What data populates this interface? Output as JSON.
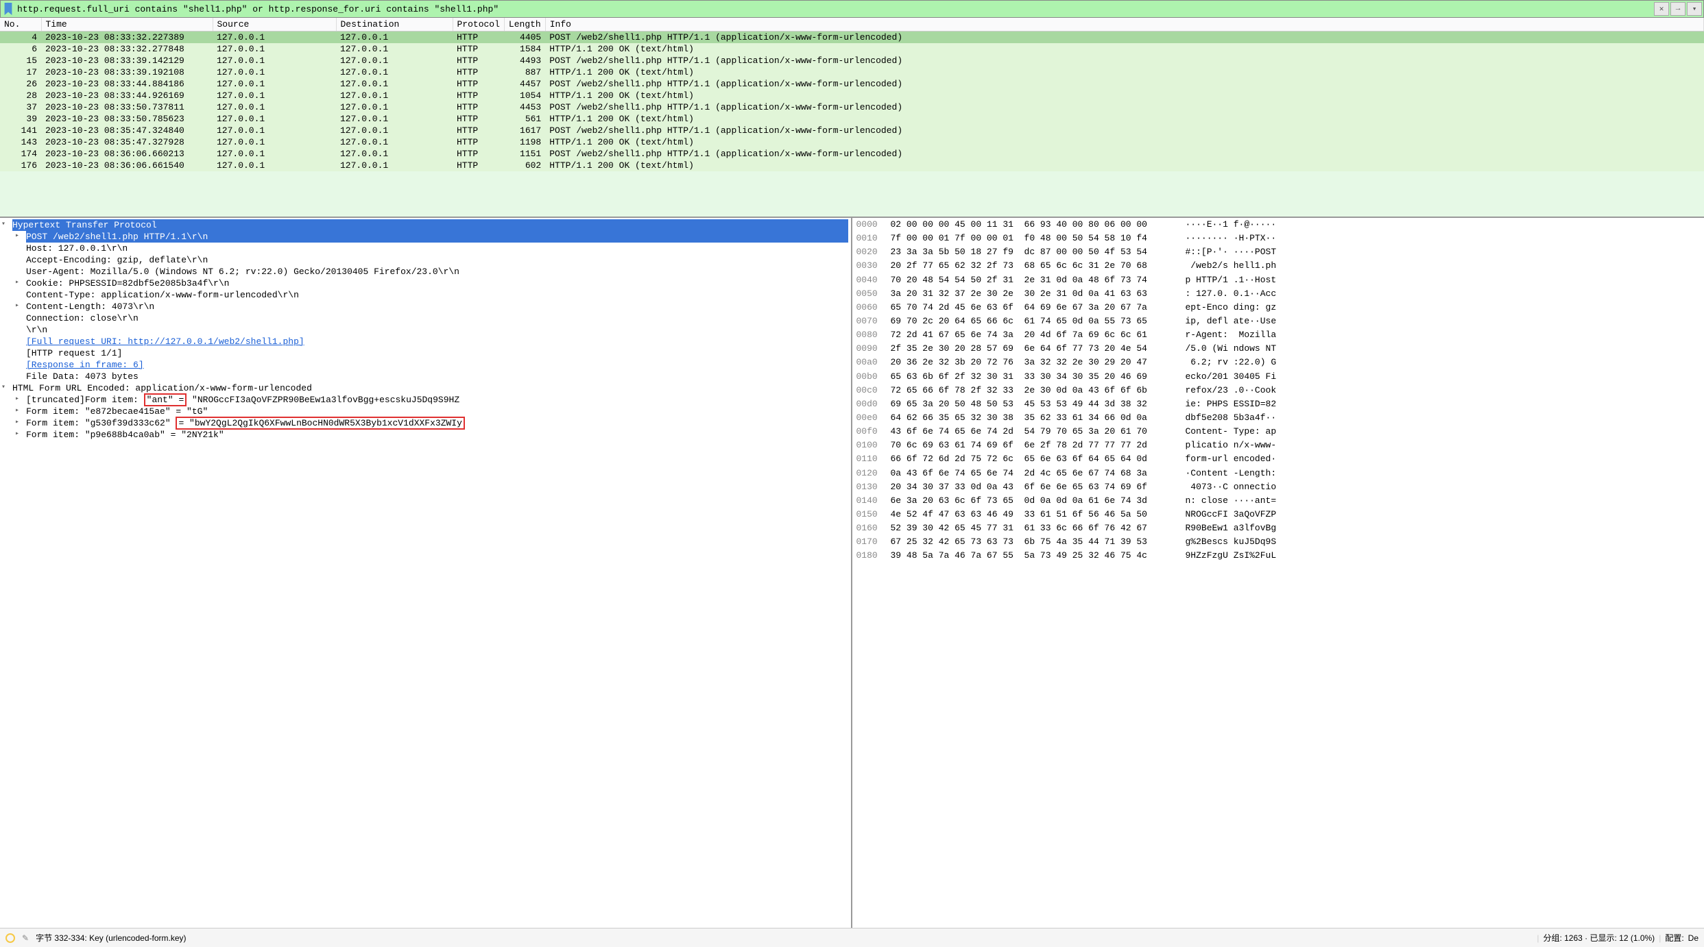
{
  "filter": {
    "text": "http.request.full_uri contains \"shell1.php\" or http.response_for.uri contains \"shell1.php\""
  },
  "columns": {
    "no": "No.",
    "time": "Time",
    "source": "Source",
    "destination": "Destination",
    "protocol": "Protocol",
    "length": "Length",
    "info": "Info"
  },
  "packets": [
    {
      "no": "4",
      "time": "2023-10-23 08:33:32.227389",
      "src": "127.0.0.1",
      "dst": "127.0.0.1",
      "proto": "HTTP",
      "len": "4405",
      "info": "POST /web2/shell1.php HTTP/1.1  (application/x-www-form-urlencoded)",
      "sel": true
    },
    {
      "no": "6",
      "time": "2023-10-23 08:33:32.277848",
      "src": "127.0.0.1",
      "dst": "127.0.0.1",
      "proto": "HTTP",
      "len": "1584",
      "info": "HTTP/1.1 200 OK  (text/html)"
    },
    {
      "no": "15",
      "time": "2023-10-23 08:33:39.142129",
      "src": "127.0.0.1",
      "dst": "127.0.0.1",
      "proto": "HTTP",
      "len": "4493",
      "info": "POST /web2/shell1.php HTTP/1.1  (application/x-www-form-urlencoded)"
    },
    {
      "no": "17",
      "time": "2023-10-23 08:33:39.192108",
      "src": "127.0.0.1",
      "dst": "127.0.0.1",
      "proto": "HTTP",
      "len": "887",
      "info": "HTTP/1.1 200 OK  (text/html)"
    },
    {
      "no": "26",
      "time": "2023-10-23 08:33:44.884186",
      "src": "127.0.0.1",
      "dst": "127.0.0.1",
      "proto": "HTTP",
      "len": "4457",
      "info": "POST /web2/shell1.php HTTP/1.1  (application/x-www-form-urlencoded)"
    },
    {
      "no": "28",
      "time": "2023-10-23 08:33:44.926169",
      "src": "127.0.0.1",
      "dst": "127.0.0.1",
      "proto": "HTTP",
      "len": "1054",
      "info": "HTTP/1.1 200 OK  (text/html)"
    },
    {
      "no": "37",
      "time": "2023-10-23 08:33:50.737811",
      "src": "127.0.0.1",
      "dst": "127.0.0.1",
      "proto": "HTTP",
      "len": "4453",
      "info": "POST /web2/shell1.php HTTP/1.1  (application/x-www-form-urlencoded)"
    },
    {
      "no": "39",
      "time": "2023-10-23 08:33:50.785623",
      "src": "127.0.0.1",
      "dst": "127.0.0.1",
      "proto": "HTTP",
      "len": "561",
      "info": "HTTP/1.1 200 OK  (text/html)"
    },
    {
      "no": "141",
      "time": "2023-10-23 08:35:47.324840",
      "src": "127.0.0.1",
      "dst": "127.0.0.1",
      "proto": "HTTP",
      "len": "1617",
      "info": "POST /web2/shell1.php HTTP/1.1  (application/x-www-form-urlencoded)"
    },
    {
      "no": "143",
      "time": "2023-10-23 08:35:47.327928",
      "src": "127.0.0.1",
      "dst": "127.0.0.1",
      "proto": "HTTP",
      "len": "1198",
      "info": "HTTP/1.1 200 OK  (text/html)"
    },
    {
      "no": "174",
      "time": "2023-10-23 08:36:06.660213",
      "src": "127.0.0.1",
      "dst": "127.0.0.1",
      "proto": "HTTP",
      "len": "1151",
      "info": "POST /web2/shell1.php HTTP/1.1  (application/x-www-form-urlencoded)"
    },
    {
      "no": "176",
      "time": "2023-10-23 08:36:06.661540",
      "src": "127.0.0.1",
      "dst": "127.0.0.1",
      "proto": "HTTP",
      "len": "602",
      "info": "HTTP/1.1 200 OK  (text/html)"
    }
  ],
  "details": {
    "http_header": "Hypertext Transfer Protocol",
    "post_line": "POST /web2/shell1.php HTTP/1.1\\r\\n",
    "host": "Host: 127.0.0.1\\r\\n",
    "accept_enc": "Accept-Encoding: gzip, deflate\\r\\n",
    "user_agent": "User-Agent: Mozilla/5.0 (Windows NT 6.2; rv:22.0) Gecko/20130405 Firefox/23.0\\r\\n",
    "cookie": "Cookie: PHPSESSID=82dbf5e2085b3a4f\\r\\n",
    "content_type": "Content-Type: application/x-www-form-urlencoded\\r\\n",
    "content_length": "Content-Length: 4073\\r\\n",
    "connection": "Connection: close\\r\\n",
    "crlf": "\\r\\n",
    "full_uri": "[Full request URI: http://127.0.0.1/web2/shell1.php]",
    "http_req": "[HTTP request 1/1]",
    "resp_frame": "[Response in frame: 6]",
    "file_data": "File Data: 4073 bytes",
    "form_header": "HTML Form URL Encoded: application/x-www-form-urlencoded",
    "form1_pre": "[truncated]Form item: ",
    "form1_key": "\"ant\" =",
    "form1_val": " \"NROGccFI3aQoVFZPR90BeEw1a3lfovBgg+escskuJ5Dq9S9HZ",
    "form2": "Form item: \"e872becae415ae\" = \"tG\"",
    "form3_pre": "Form item: \"g530f39d333c62\" ",
    "form3_val": "= \"bwY2QgL2QgIkQ6XFwwLnBocHN0dWR5X3Byb1xcV1dXXFx3ZWIy",
    "form4": "Form item: \"p9e688b4ca0ab\" = \"2NY21k\""
  },
  "hex": [
    {
      "off": "0000",
      "b": "02 00 00 00 45 00 11 31  66 93 40 00 80 06 00 00",
      "a": "····E··1 f·@·····"
    },
    {
      "off": "0010",
      "b": "7f 00 00 01 7f 00 00 01  f0 48 00 50 54 58 10 f4",
      "a": "········ ·H·PTX··"
    },
    {
      "off": "0020",
      "b": "23 3a 3a 5b 50 18 27 f9  dc 87 00 00 50 4f 53 54",
      "a": "#::[P·'· ····POST"
    },
    {
      "off": "0030",
      "b": "20 2f 77 65 62 32 2f 73  68 65 6c 6c 31 2e 70 68",
      "a": " /web2/s hell1.ph"
    },
    {
      "off": "0040",
      "b": "70 20 48 54 54 50 2f 31  2e 31 0d 0a 48 6f 73 74",
      "a": "p HTTP/1 .1··Host"
    },
    {
      "off": "0050",
      "b": "3a 20 31 32 37 2e 30 2e  30 2e 31 0d 0a 41 63 63",
      "a": ": 127.0. 0.1··Acc"
    },
    {
      "off": "0060",
      "b": "65 70 74 2d 45 6e 63 6f  64 69 6e 67 3a 20 67 7a",
      "a": "ept-Enco ding: gz"
    },
    {
      "off": "0070",
      "b": "69 70 2c 20 64 65 66 6c  61 74 65 0d 0a 55 73 65",
      "a": "ip, defl ate··Use"
    },
    {
      "off": "0080",
      "b": "72 2d 41 67 65 6e 74 3a  20 4d 6f 7a 69 6c 6c 61",
      "a": "r-Agent:  Mozilla"
    },
    {
      "off": "0090",
      "b": "2f 35 2e 30 20 28 57 69  6e 64 6f 77 73 20 4e 54",
      "a": "/5.0 (Wi ndows NT"
    },
    {
      "off": "00a0",
      "b": "20 36 2e 32 3b 20 72 76  3a 32 32 2e 30 29 20 47",
      "a": " 6.2; rv :22.0) G"
    },
    {
      "off": "00b0",
      "b": "65 63 6b 6f 2f 32 30 31  33 30 34 30 35 20 46 69",
      "a": "ecko/201 30405 Fi"
    },
    {
      "off": "00c0",
      "b": "72 65 66 6f 78 2f 32 33  2e 30 0d 0a 43 6f 6f 6b",
      "a": "refox/23 .0··Cook"
    },
    {
      "off": "00d0",
      "b": "69 65 3a 20 50 48 50 53  45 53 53 49 44 3d 38 32",
      "a": "ie: PHPS ESSID=82"
    },
    {
      "off": "00e0",
      "b": "64 62 66 35 65 32 30 38  35 62 33 61 34 66 0d 0a",
      "a": "dbf5e208 5b3a4f··"
    },
    {
      "off": "00f0",
      "b": "43 6f 6e 74 65 6e 74 2d  54 79 70 65 3a 20 61 70",
      "a": "Content- Type: ap"
    },
    {
      "off": "0100",
      "b": "70 6c 69 63 61 74 69 6f  6e 2f 78 2d 77 77 77 2d",
      "a": "plicatio n/x-www-"
    },
    {
      "off": "0110",
      "b": "66 6f 72 6d 2d 75 72 6c  65 6e 63 6f 64 65 64 0d",
      "a": "form-url encoded·"
    },
    {
      "off": "0120",
      "b": "0a 43 6f 6e 74 65 6e 74  2d 4c 65 6e 67 74 68 3a",
      "a": "·Content -Length:"
    },
    {
      "off": "0130",
      "b": "20 34 30 37 33 0d 0a 43  6f 6e 6e 65 63 74 69 6f",
      "a": " 4073··C onnectio"
    },
    {
      "off": "0140",
      "b": "6e 3a 20 63 6c 6f 73 65  0d 0a 0d 0a 61 6e 74 3d",
      "a": "n: close ····ant="
    },
    {
      "off": "0150",
      "b": "4e 52 4f 47 63 63 46 49  33 61 51 6f 56 46 5a 50",
      "a": "NROGccFI 3aQoVFZP"
    },
    {
      "off": "0160",
      "b": "52 39 30 42 65 45 77 31  61 33 6c 66 6f 76 42 67",
      "a": "R90BeEw1 a3lfovBg"
    },
    {
      "off": "0170",
      "b": "67 25 32 42 65 73 63 73  6b 75 4a 35 44 71 39 53",
      "a": "g%2Bescs kuJ5Dq9S"
    },
    {
      "off": "0180",
      "b": "39 48 5a 7a 46 7a 67 55  5a 73 49 25 32 46 75 4c",
      "a": "9HZzFzgU ZsI%2FuL"
    }
  ],
  "status": {
    "bytes_label": "字节 332-334: Key (urlencoded-form.key)",
    "pkts": "分组: 1263 · 已显示: 12 (1.0%)",
    "profile_label": "配置:",
    "profile_value": "De"
  }
}
